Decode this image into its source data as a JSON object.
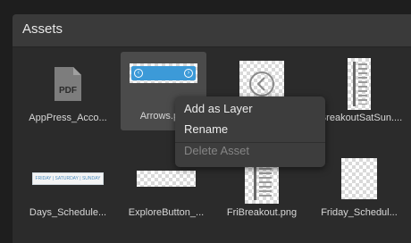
{
  "panel": {
    "title": "Assets"
  },
  "assets": [
    {
      "label": "AppPress_Acco...",
      "thumbnail": "pdf-file-icon",
      "thumb_text": "PDF",
      "selected": false
    },
    {
      "label": "Arrows.p...",
      "thumbnail": "arrows-image",
      "selected": true
    },
    {
      "label": "",
      "thumbnail": "back-button-image",
      "selected": false
    },
    {
      "label": "BreakoutSatSun....",
      "thumbnail": "schedule-image",
      "selected": false
    },
    {
      "label": "Days_Schedule...",
      "thumbnail": "days-bar-image",
      "thumb_text": "FRIDAY | SATURDAY | SUNDAY",
      "selected": false
    },
    {
      "label": "ExploreButton_...",
      "thumbnail": "checker-image",
      "selected": false
    },
    {
      "label": "FriBreakout.png",
      "thumbnail": "schedule-image",
      "selected": false
    },
    {
      "label": "Friday_Schedul...",
      "thumbnail": "schedule-image",
      "selected": false
    }
  ],
  "context_menu": {
    "items": [
      {
        "label": "Add as Layer",
        "enabled": true
      },
      {
        "label": "Rename",
        "enabled": true
      },
      {
        "label": "Delete Asset",
        "enabled": false
      }
    ]
  },
  "colors": {
    "background": "#1e1e1e",
    "panel": "#2b2b2b",
    "header": "#3a3a3a",
    "selected": "#4b4b4b",
    "accent_blue": "#3c9ad8",
    "menu": "#3d3d3d"
  }
}
